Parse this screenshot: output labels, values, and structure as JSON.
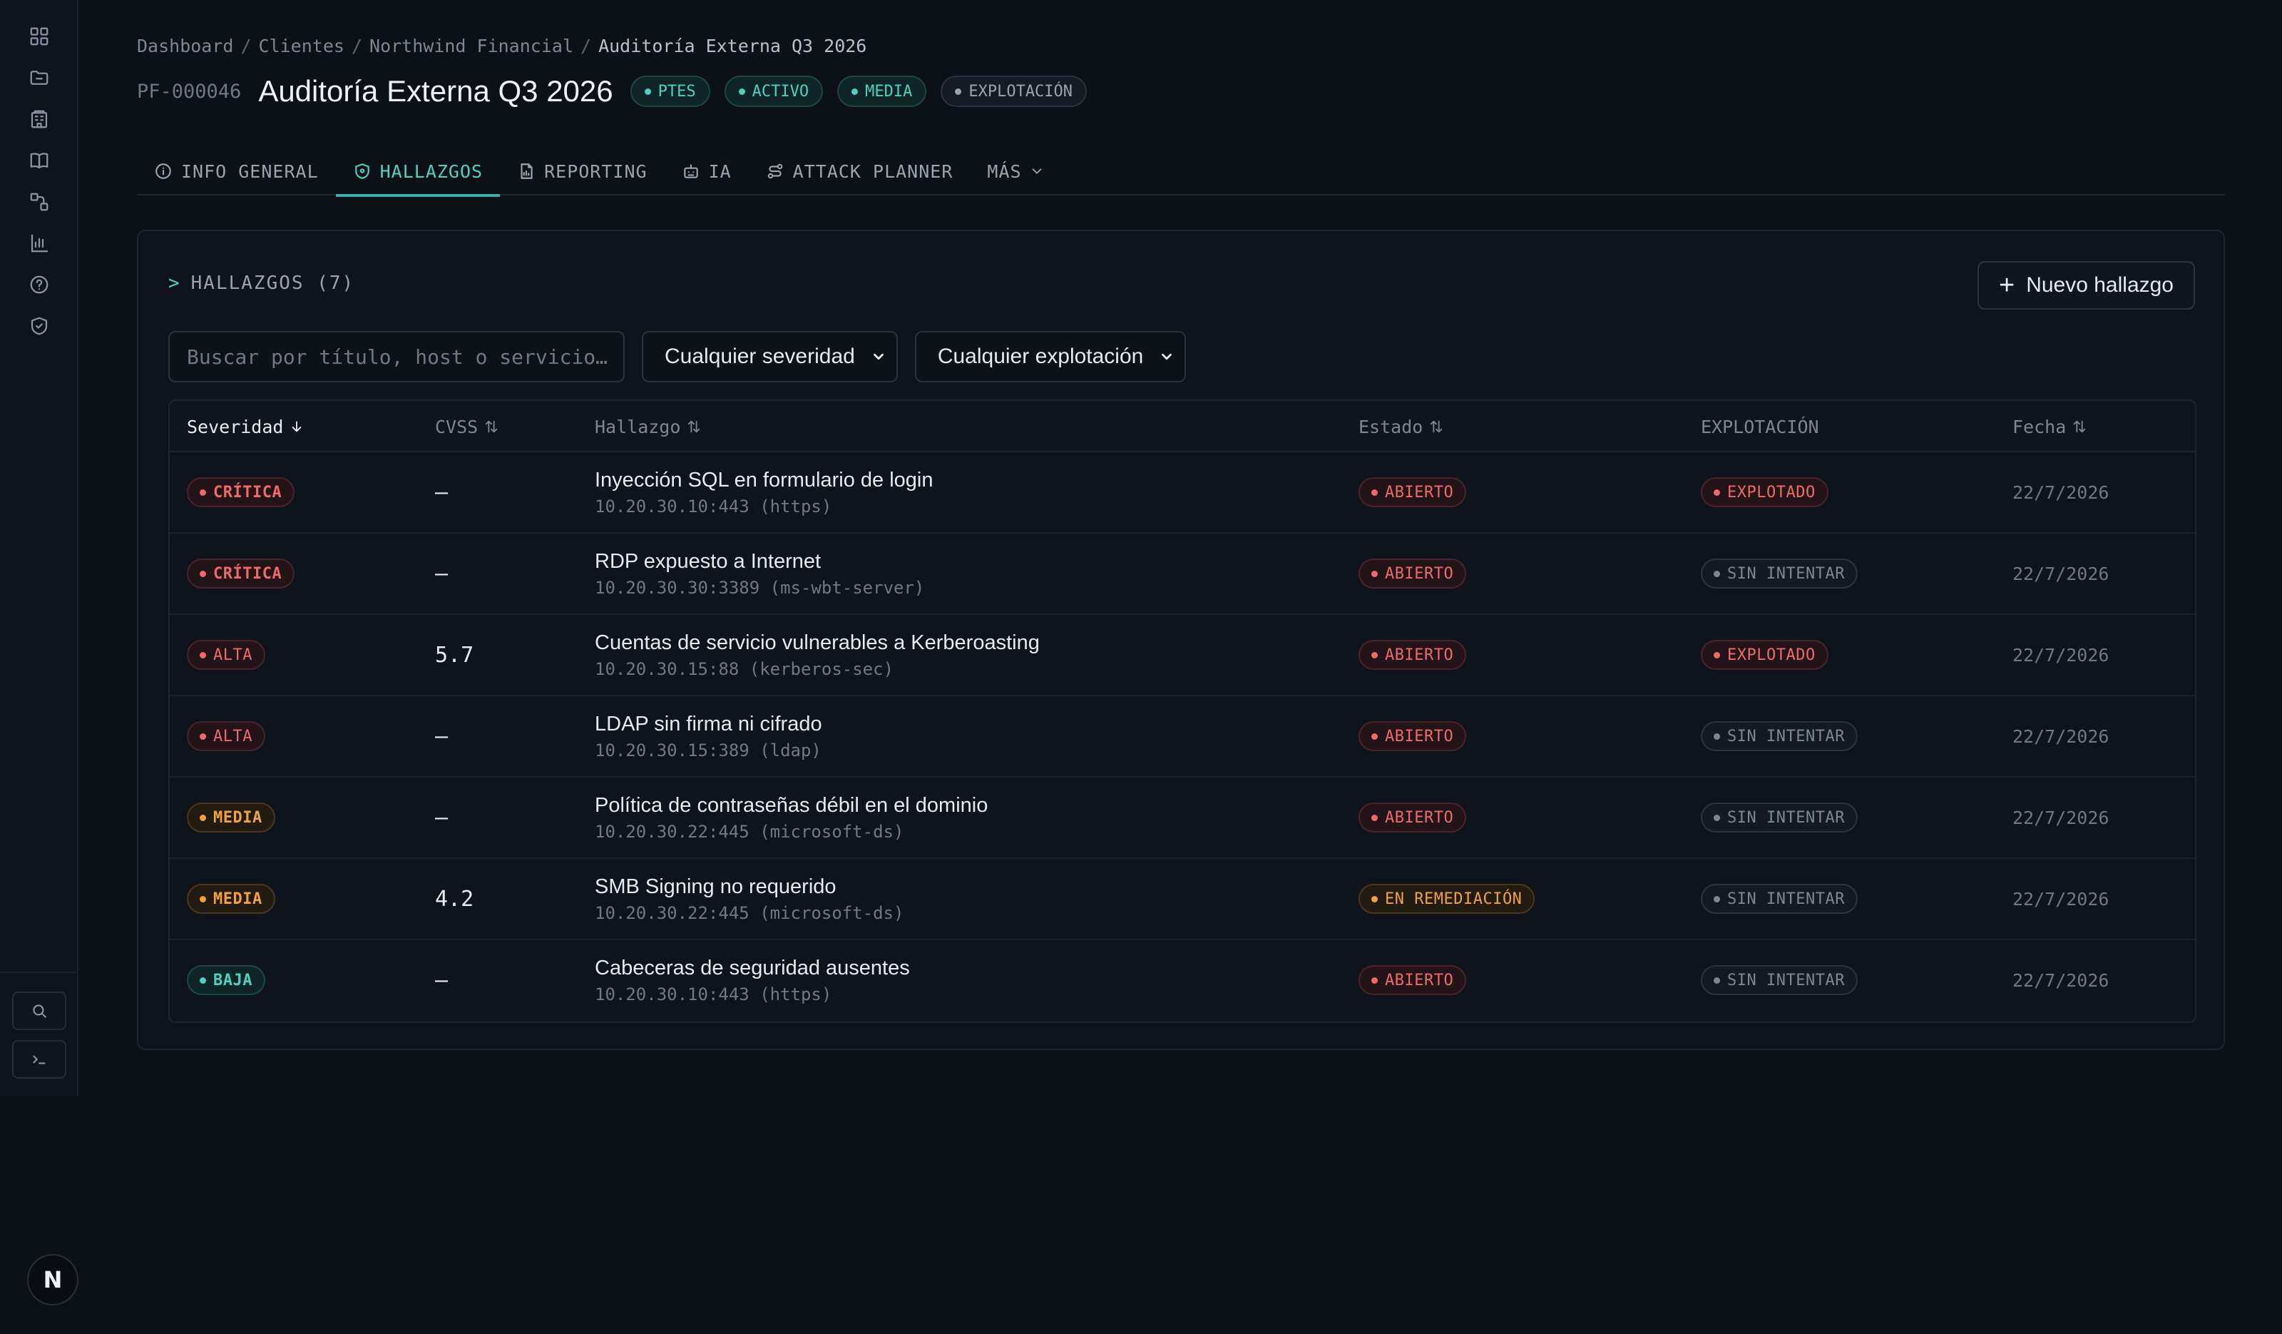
{
  "breadcrumb": {
    "items": [
      "Dashboard",
      "Clientes",
      "Northwind Financial"
    ],
    "current": "Auditoría Externa Q3 2026"
  },
  "header": {
    "project_id": "PF-000046",
    "title": "Auditoría Externa Q3 2026",
    "chips": [
      "PTES",
      "ACTIVO",
      "MEDIA",
      "EXPLOTACIÓN"
    ]
  },
  "tabs": [
    {
      "label": "INFO GENERAL",
      "icon": "info-icon"
    },
    {
      "label": "HALLAZGOS",
      "icon": "shield-icon"
    },
    {
      "label": "REPORTING",
      "icon": "report-icon"
    },
    {
      "label": "IA",
      "icon": "robot-icon"
    },
    {
      "label": "ATTACK PLANNER",
      "icon": "route-icon"
    },
    {
      "label": "MÁS",
      "icon": "chevron-down-icon"
    }
  ],
  "panel": {
    "prompt": ">",
    "heading": "HALLAZGOS (7)",
    "new_button": "Nuevo hallazgo"
  },
  "filters": {
    "search_placeholder": "Buscar por título, host o servicio…",
    "severity": "Cualquier severidad",
    "exploitation": "Cualquier explotación"
  },
  "table": {
    "headers": {
      "severity": "Severidad",
      "cvss": "CVSS",
      "finding": "Hallazgo",
      "status": "Estado",
      "exploitation": "EXPLOTACIÓN",
      "date": "Fecha"
    },
    "rows": [
      {
        "severity": "CRÍTICA",
        "cvss": "–",
        "title": "Inyección SQL en formulario de login",
        "host": "10.20.30.10:443 (https)",
        "status": "ABIERTO",
        "exploitation": "EXPLOTADO",
        "date": "22/7/2026"
      },
      {
        "severity": "CRÍTICA",
        "cvss": "–",
        "title": "RDP expuesto a Internet",
        "host": "10.20.30.30:3389 (ms-wbt-server)",
        "status": "ABIERTO",
        "exploitation": "SIN INTENTAR",
        "date": "22/7/2026"
      },
      {
        "severity": "ALTA",
        "cvss": "5.7",
        "title": "Cuentas de servicio vulnerables a Kerberoasting",
        "host": "10.20.30.15:88 (kerberos-sec)",
        "status": "ABIERTO",
        "exploitation": "EXPLOTADO",
        "date": "22/7/2026"
      },
      {
        "severity": "ALTA",
        "cvss": "–",
        "title": "LDAP sin firma ni cifrado",
        "host": "10.20.30.15:389 (ldap)",
        "status": "ABIERTO",
        "exploitation": "SIN INTENTAR",
        "date": "22/7/2026"
      },
      {
        "severity": "MEDIA",
        "cvss": "–",
        "title": "Política de contraseñas débil en el dominio",
        "host": "10.20.30.22:445 (microsoft-ds)",
        "status": "ABIERTO",
        "exploitation": "SIN INTENTAR",
        "date": "22/7/2026"
      },
      {
        "severity": "MEDIA",
        "cvss": "4.2",
        "title": "SMB Signing no requerido",
        "host": "10.20.30.22:445 (microsoft-ds)",
        "status": "EN REMEDIACIÓN",
        "exploitation": "SIN INTENTAR",
        "date": "22/7/2026"
      },
      {
        "severity": "BAJA",
        "cvss": "–",
        "title": "Cabeceras de seguridad ausentes",
        "host": "10.20.30.10:443 (https)",
        "status": "ABIERTO",
        "exploitation": "SIN INTENTAR",
        "date": "22/7/2026"
      }
    ]
  },
  "user": {
    "avatar_letter": "N"
  },
  "colors": {
    "accent": "#4fd1c1",
    "critical": "#f06a6a",
    "medium": "#f2a13c",
    "background": "#0c1017"
  }
}
